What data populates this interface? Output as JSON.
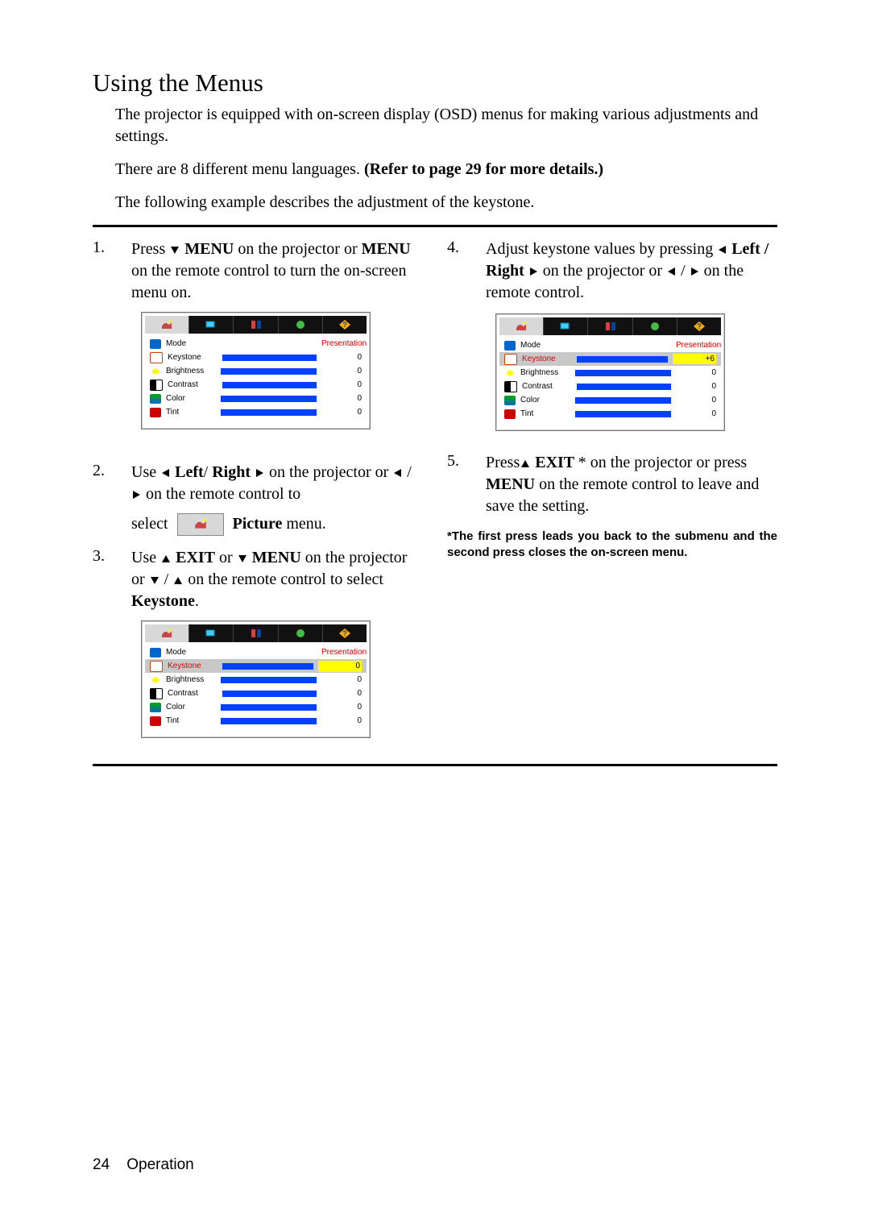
{
  "heading": "Using the Menus",
  "intro": {
    "p1": "The projector is equipped with on-screen display (OSD) menus for making various adjustments and settings.",
    "p2a": "There are 8 different menu languages. ",
    "p2b": "(Refer to page 29 for more details.)",
    "p3": "The following example describes the adjustment of the keystone."
  },
  "steps": {
    "s1": {
      "num": "1.",
      "a": "Press ",
      "b": " MENU",
      "c": " on the projector or ",
      "d": "MENU",
      "e": " on the remote control to turn the on-screen menu on."
    },
    "s2": {
      "num": "2.",
      "a": "Use ",
      "b": " Left",
      "c": "/ ",
      "d": "Right ",
      "e": " on the projector or ",
      "f": " / ",
      "g": " on the remote control to",
      "h": "select ",
      "i": "Picture",
      "j": " menu."
    },
    "s3": {
      "num": "3.",
      "a": "Use ",
      "b": " EXIT",
      "c": " or ",
      "d": " MENU",
      "e": " on the projector or ",
      "f": " / ",
      "g": " on the remote control to select ",
      "h": "Keystone",
      "i": "."
    },
    "s4": {
      "num": "4.",
      "a": "Adjust keystone values by pressing ",
      "b": " Left / Right ",
      "c": " on the projector or ",
      "d": " / ",
      "e": " on the remote control."
    },
    "s5": {
      "num": "5.",
      "a": "Press",
      "b": " EXIT ",
      "c": "* on the projector or press ",
      "d": "MENU ",
      "e": " on the remote control to leave and save the setting."
    }
  },
  "footnote": "*The first press leads you back to the submenu and the second press closes the on-screen menu.",
  "osd": {
    "mode_label": "Mode",
    "mode_value": "Presentation",
    "keystone_label": "Keystone",
    "brightness_label": "Brightness",
    "contrast_label": "Contrast",
    "color_label": "Color",
    "tint_label": "Tint",
    "val0": "0",
    "val_plus6": "+6"
  },
  "footer": {
    "page": "24",
    "section": "Operation"
  }
}
